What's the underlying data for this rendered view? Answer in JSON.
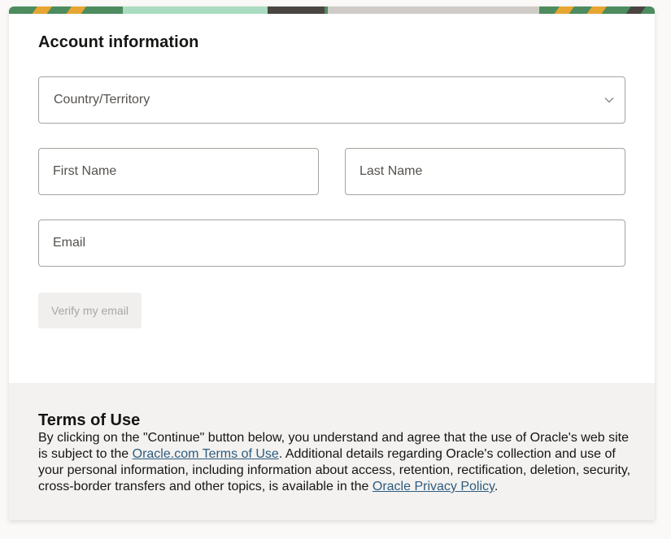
{
  "form": {
    "section_title": "Account information",
    "country_placeholder": "Country/Territory",
    "first_name_placeholder": "First Name",
    "last_name_placeholder": "Last Name",
    "email_placeholder": "Email",
    "verify_button_label": "Verify my email",
    "dropdown_icon": "chevron-down-icon"
  },
  "terms": {
    "title": "Terms of Use",
    "text_1": "By clicking on the \"Continue\" button below, you understand and agree that the use of Oracle's web site is subject to the ",
    "link_terms": "Oracle.com Terms of Use",
    "text_2": ". Additional details regarding Oracle's collection and use of your personal information, including information about access, retention, rectification, deletion, security, cross-border transfers and other topics, is available in the ",
    "link_privacy": "Oracle Privacy Policy",
    "text_3": "."
  },
  "colors": {
    "link": "#2e5c80",
    "banner_green": "#4d8c5f",
    "banner_orange": "#e7a531",
    "terms_background": "#f3f2f0"
  }
}
